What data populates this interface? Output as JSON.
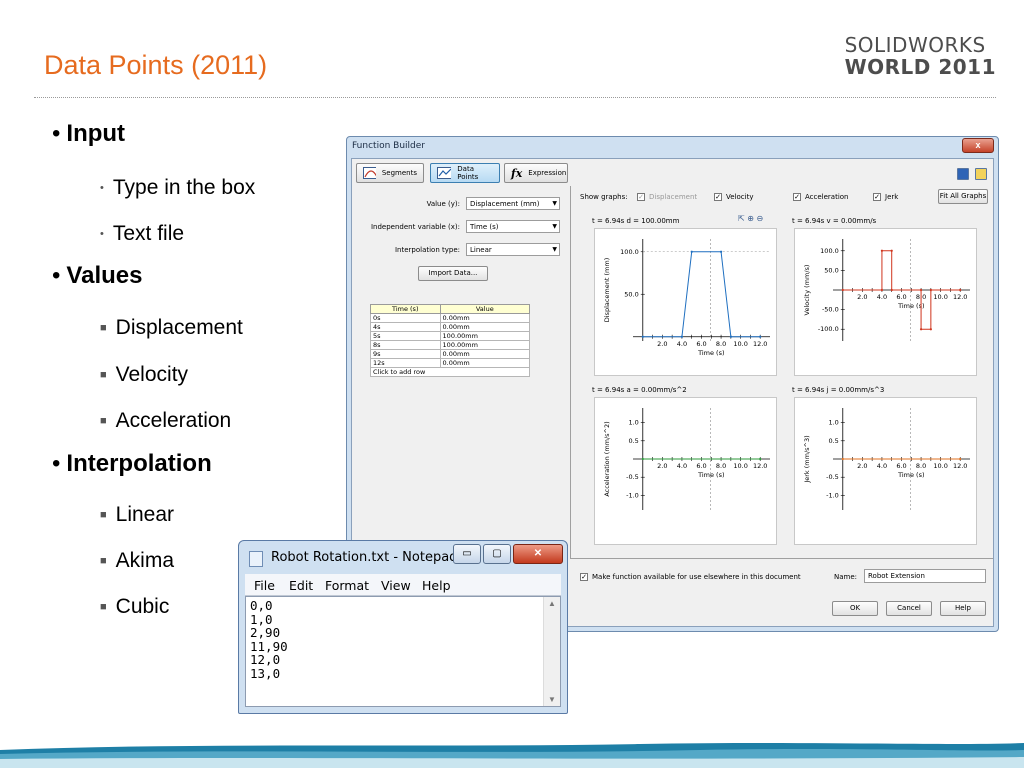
{
  "slide": {
    "title": "Data Points (2011)",
    "brand_line1": "SOLIDWORKS",
    "brand_line2": "WORLD 2011",
    "bullets": [
      {
        "label": "Input",
        "sub": [
          "Type in the box",
          "Text file"
        ]
      },
      {
        "label": "Values",
        "sub": [
          "Displacement",
          "Velocity",
          "Acceleration"
        ]
      },
      {
        "label": "Interpolation",
        "sub": [
          "Linear",
          "Akima",
          "Cubic"
        ]
      }
    ],
    "colors": {
      "title": "#e66b1f",
      "wave": "#2a8fb5"
    }
  },
  "function_builder": {
    "title": "Function Builder",
    "close_label": "x",
    "tabs": [
      {
        "label": "Segments",
        "icon": "segments-icon",
        "active": false
      },
      {
        "label": "Data Points",
        "icon": "data-points-icon",
        "active": true
      },
      {
        "label": "Expression",
        "icon": "expression-icon",
        "active": false
      }
    ],
    "value_label": "Value (y):",
    "value_selected": "Displacement (mm)",
    "indep_label": "Independent variable (x):",
    "indep_selected": "Time (s)",
    "interp_label": "Interpolation type:",
    "interp_selected": "Linear",
    "import_button": "Import Data...",
    "table": {
      "headers": [
        "Time (s)",
        "Value"
      ],
      "rows": [
        [
          "0s",
          "0.00mm"
        ],
        [
          "4s",
          "0.00mm"
        ],
        [
          "5s",
          "100.00mm"
        ],
        [
          "8s",
          "100.00mm"
        ],
        [
          "9s",
          "0.00mm"
        ],
        [
          "12s",
          "0.00mm"
        ]
      ],
      "add_row": "Click to add row"
    },
    "show_graphs_label": "Show graphs:",
    "show_graphs": [
      {
        "label": "Displacement",
        "checked": true,
        "disabled": true
      },
      {
        "label": "Velocity",
        "checked": true,
        "disabled": false
      },
      {
        "label": "Acceleration",
        "checked": true,
        "disabled": false
      },
      {
        "label": "Jerk",
        "checked": true,
        "disabled": false
      }
    ],
    "fit_button": "Fit All Graphs",
    "plot_labels": [
      "t = 6.94s  d = 100.00mm",
      "t = 6.94s  v = 0.00mm/s",
      "t = 6.94s  a = 0.00mm/s^2",
      "t = 6.94s  j = 0.00mm/s^3"
    ],
    "make_available_label": "Make function available for use elsewhere in this document",
    "make_available_checked": true,
    "name_label": "Name:",
    "name_value": "Robot Extension",
    "ok": "OK",
    "cancel": "Cancel",
    "help": "Help"
  },
  "chart_data": [
    {
      "type": "line",
      "xlabel": "Time (s)",
      "ylabel": "Displacement (mm)",
      "x": [
        0,
        4,
        5,
        8,
        9,
        12
      ],
      "values": [
        0,
        0,
        100,
        100,
        0,
        0
      ],
      "xticks": [
        "2.0",
        "4.0",
        "6.0",
        "8.0",
        "10.0",
        "12.0"
      ],
      "yticks": [
        "50.0",
        "100.0"
      ],
      "xlim": [
        -1,
        13
      ],
      "ylim": [
        -5,
        115
      ],
      "cursor_x": 6.94,
      "color": "#1f6fc0"
    },
    {
      "type": "line",
      "xlabel": "Time (s)",
      "ylabel": "Velocity (mm/s)",
      "x": [
        0,
        4,
        4,
        5,
        5,
        8,
        8,
        9,
        9,
        12
      ],
      "values": [
        0,
        0,
        100,
        100,
        0,
        0,
        -100,
        -100,
        0,
        0
      ],
      "xticks": [
        "2.0",
        "4.0",
        "6.0",
        "8.0",
        "10.0",
        "12.0"
      ],
      "yticks": [
        "-100.0",
        "-50.0",
        "50.0",
        "100.0"
      ],
      "xlim": [
        -1,
        13
      ],
      "ylim": [
        -130,
        130
      ],
      "cursor_x": 6.94,
      "color": "#d0341c"
    },
    {
      "type": "line",
      "xlabel": "Time (s)",
      "ylabel": "Acceleration (mm/s^2)",
      "x": [
        0,
        12
      ],
      "values": [
        0,
        0
      ],
      "xticks": [
        "2.0",
        "4.0",
        "6.0",
        "8.0",
        "10.0",
        "12.0"
      ],
      "yticks": [
        "-1.0",
        "-0.5",
        "0.5",
        "1.0"
      ],
      "xlim": [
        -1,
        13
      ],
      "ylim": [
        -1.4,
        1.4
      ],
      "cursor_x": 6.94,
      "color": "#2b9a3a"
    },
    {
      "type": "line",
      "xlabel": "Time (s)",
      "ylabel": "Jerk (mm/s^3)",
      "x": [
        0,
        12
      ],
      "values": [
        0,
        0
      ],
      "xticks": [
        "2.0",
        "4.0",
        "6.0",
        "8.0",
        "10.0",
        "12.0"
      ],
      "yticks": [
        "-1.0",
        "-0.5",
        "0.5",
        "1.0"
      ],
      "xlim": [
        -1,
        13
      ],
      "ylim": [
        -1.4,
        1.4
      ],
      "cursor_x": 6.94,
      "color": "#e07020"
    }
  ],
  "notepad": {
    "title": "Robot Rotation.txt - Notepad",
    "menu": [
      "File",
      "Edit",
      "Format",
      "View",
      "Help"
    ],
    "lines": [
      "0,0",
      "1,0",
      "2,90",
      "11,90",
      "12,0",
      "13,0"
    ],
    "min_glyph": "▭",
    "max_glyph": "▢",
    "close_glyph": "✕"
  }
}
